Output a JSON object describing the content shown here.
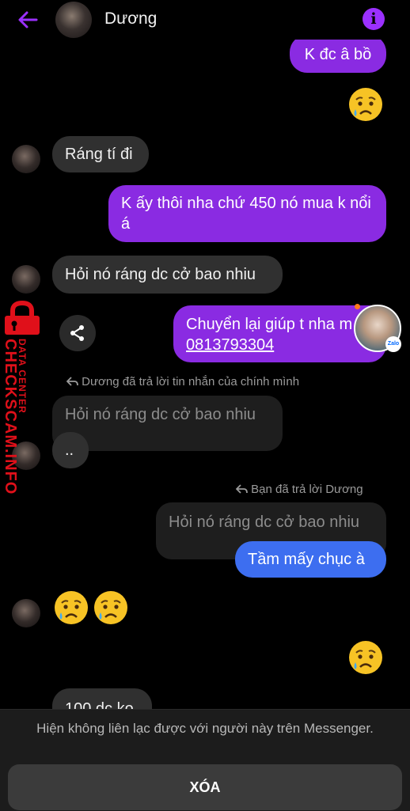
{
  "header": {
    "contact_name": "Dương",
    "info_glyph": "i"
  },
  "messages": {
    "m1": "K đc â bồ",
    "m2": "Ráng tí đi",
    "m3": "K ấy thôi nha chứ 450 nó mua k nổi á",
    "m4": "Hỏi nó ráng dc cở bao nhiu",
    "m5_text": "Chuyển lại giúp t nha m",
    "m5_phone": "0813793304",
    "reply_note_1": "Dương đã trả lời tin nhắn của chính mình",
    "quote_1": "Hỏi nó ráng dc cở bao nhiu",
    "m6": "..",
    "reply_note_2": "Bạn đã trả lời Dương",
    "quote_2": "Hỏi nó ráng dc cở bao nhiu",
    "m7": "Tầm mấy chục à",
    "m8_partial": "100 dc ko"
  },
  "zalo_badge": "Zalo",
  "watermark": {
    "line1": "DATA CENTER",
    "line2": "CHECKSCAM.INFO"
  },
  "bottom": {
    "notice": "Hiện không liên lạc được với người này trên Messenger.",
    "delete_label": "XÓA"
  },
  "colors": {
    "accent": "#8a2be2",
    "reply_blue": "#3d6ef0",
    "incoming": "#303030",
    "watermark_red": "#e0101a"
  },
  "icons": [
    "back-arrow-icon",
    "info-icon",
    "share-icon",
    "reply-arrow-icon",
    "crying-face-emoji"
  ]
}
